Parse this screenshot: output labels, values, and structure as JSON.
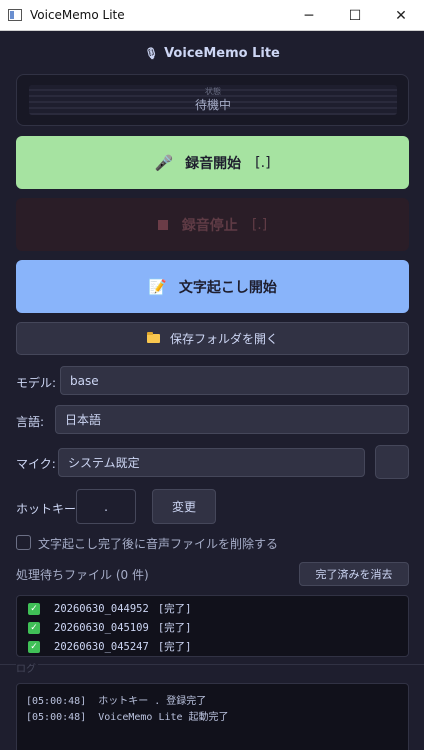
{
  "window": {
    "title": "VoiceMemo Lite",
    "minimize": "─",
    "maximize": "☐",
    "close": "✕"
  },
  "header": {
    "title": "VoiceMemo Lite",
    "icon": "microphone-icon"
  },
  "status": {
    "label": "状態",
    "text": "待機中"
  },
  "record_button": {
    "icon": "🎤",
    "label": "録音開始",
    "hotkey": "[.]"
  },
  "stop_button": {
    "label": "録音停止",
    "hotkey": "[.]"
  },
  "transcribe_button": {
    "icon": "📝",
    "label": "文字起こし開始"
  },
  "folder_button": {
    "label": "保存フォルダを開く",
    "icon": "folder-icon"
  },
  "model": {
    "label": "モデル:",
    "value": "base"
  },
  "language": {
    "label": "言語:",
    "value": "日本語"
  },
  "mic": {
    "label": "マイク:",
    "value": "システム既定"
  },
  "hotkey": {
    "label": "ホットキー:",
    "value": ".",
    "change_label": "変更"
  },
  "delete_option": {
    "label": "文字起こし完了後に音声ファイルを削除する",
    "checked": false
  },
  "queue": {
    "label": "処理待ちファイル (0 件)",
    "clear_label": "完了済みを消去",
    "items": [
      {
        "name": "20260630_044952",
        "status": "[完了]"
      },
      {
        "name": "20260630_045109",
        "status": "[完了]"
      },
      {
        "name": "20260630_045247",
        "status": "[完了]"
      }
    ]
  },
  "log": {
    "label": "ログ",
    "lines": [
      "[05:00:48]  ホットキー . 登録完了",
      "[05:00:48]  VoiceMemo Lite 起動完了"
    ]
  },
  "colors": {
    "background": "#1e1e2e",
    "record": "#a6e3a1",
    "transcribe": "#89b4fa",
    "stop": "#2a1d27",
    "check": "#40c057"
  }
}
